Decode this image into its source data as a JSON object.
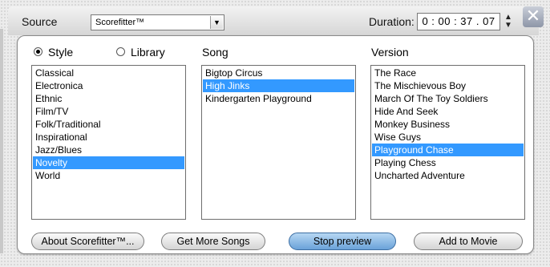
{
  "header": {
    "source_label": "Source",
    "source_value": "Scorefitter™",
    "duration_label": "Duration:",
    "duration_value": "0 : 00 : 37 . 07",
    "close_glyph": "✕"
  },
  "columns": {
    "style_label": "Style",
    "library_label": "Library",
    "song_label": "Song",
    "version_label": "Version"
  },
  "styles": [
    {
      "label": "Classical",
      "selected": false
    },
    {
      "label": "Electronica",
      "selected": false
    },
    {
      "label": "Ethnic",
      "selected": false
    },
    {
      "label": "Film/TV",
      "selected": false
    },
    {
      "label": "Folk/Traditional",
      "selected": false
    },
    {
      "label": "Inspirational",
      "selected": false
    },
    {
      "label": "Jazz/Blues",
      "selected": false
    },
    {
      "label": "Novelty",
      "selected": true
    },
    {
      "label": "World",
      "selected": false
    }
  ],
  "songs": [
    {
      "label": "Bigtop Circus",
      "selected": false
    },
    {
      "label": "High Jinks",
      "selected": true
    },
    {
      "label": "Kindergarten Playground",
      "selected": false
    }
  ],
  "versions": [
    {
      "label": "The Race",
      "selected": false
    },
    {
      "label": "The Mischievous Boy",
      "selected": false
    },
    {
      "label": "March Of The Toy Soldiers",
      "selected": false
    },
    {
      "label": "Hide And Seek",
      "selected": false
    },
    {
      "label": "Monkey Business",
      "selected": false
    },
    {
      "label": "Wise Guys",
      "selected": false
    },
    {
      "label": "Playground Chase",
      "selected": true
    },
    {
      "label": "Playing Chess",
      "selected": false
    },
    {
      "label": "Uncharted Adventure",
      "selected": false
    }
  ],
  "buttons": {
    "about": "About Scorefitter™...",
    "more_songs": "Get More Songs",
    "stop_preview": "Stop preview",
    "add_to_movie": "Add to Movie"
  },
  "colors": {
    "selection": "#3399ff",
    "primary_button": "#6aa2d9"
  }
}
